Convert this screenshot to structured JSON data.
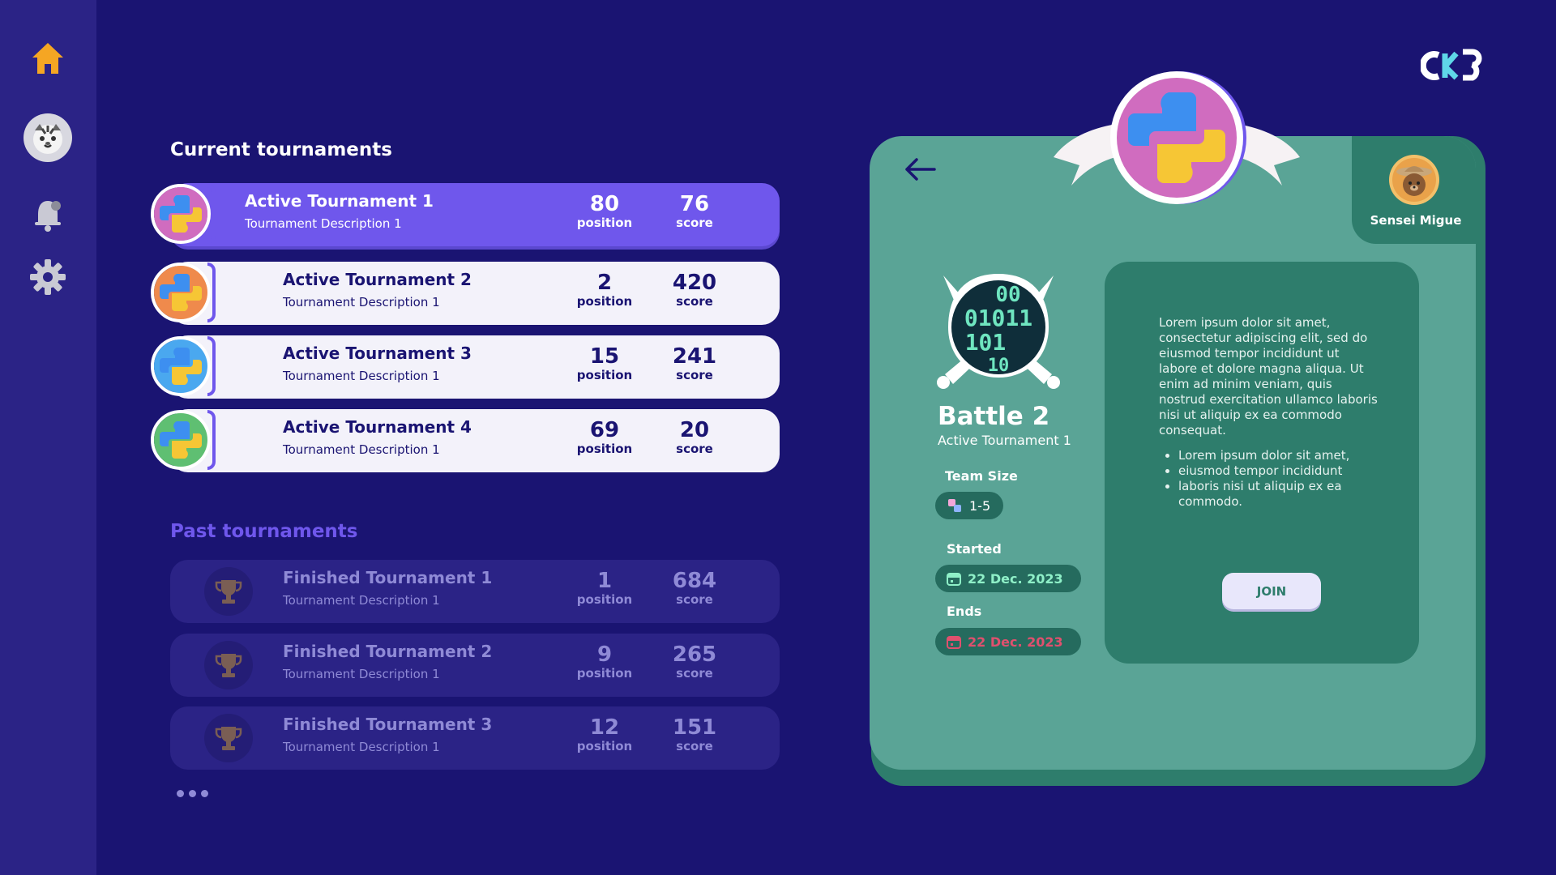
{
  "sidebar": {
    "items": [
      {
        "icon": "home-icon"
      },
      {
        "icon": "avatar-tiger-icon"
      },
      {
        "icon": "bell-icon"
      },
      {
        "icon": "gear-icon"
      }
    ]
  },
  "brand": {
    "logo": "ck3-logo"
  },
  "current": {
    "title": "Current tournaments",
    "rows": [
      {
        "name": "Active Tournament 1",
        "desc": "Tournament Description 1",
        "position": "80",
        "score": "76",
        "position_label": "position",
        "score_label": "score",
        "badge_color": "#d06cbf"
      },
      {
        "name": "Active Tournament 2",
        "desc": "Tournament Description 1",
        "position": "2",
        "score": "420",
        "position_label": "position",
        "score_label": "score",
        "badge_color": "#ef8a4c"
      },
      {
        "name": "Active Tournament 3",
        "desc": "Tournament Description 1",
        "position": "15",
        "score": "241",
        "position_label": "position",
        "score_label": "score",
        "badge_color": "#4aa8ef"
      },
      {
        "name": "Active Tournament 4",
        "desc": "Tournament Description 1",
        "position": "69",
        "score": "20",
        "position_label": "position",
        "score_label": "score",
        "badge_color": "#5fbf72"
      }
    ]
  },
  "past": {
    "title": "Past tournaments",
    "rows": [
      {
        "name": "Finished Tournament 1",
        "desc": "Tournament Description 1",
        "position": "1",
        "score": "684",
        "position_label": "position",
        "score_label": "score"
      },
      {
        "name": "Finished Tournament 2",
        "desc": "Tournament Description 1",
        "position": "9",
        "score": "265",
        "position_label": "position",
        "score_label": "score"
      },
      {
        "name": "Finished Tournament 3",
        "desc": "Tournament Description 1",
        "position": "12",
        "score": "151",
        "position_label": "position",
        "score_label": "score"
      }
    ]
  },
  "detail": {
    "battle_title": "Battle 2",
    "battle_subtitle": "Active Tournament 1",
    "team_size_label": "Team Size",
    "team_size": "1-5",
    "started_label": "Started",
    "started_date": "22 Dec. 2023",
    "ends_label": "Ends",
    "ends_date": "22 Dec. 2023",
    "tutor_name": "Sensei Migue",
    "description": "Lorem ipsum dolor sit amet, consectetur adipiscing elit, sed do eiusmod tempor incididunt ut labore et dolore magna aliqua. Ut enim ad minim veniam, quis nostrud exercitation ullamco laboris nisi ut aliquip ex ea commodo consequat.",
    "bullets": [
      "Lorem ipsum dolor sit amet,",
      "eiusmod tempor incididunt",
      "laboris nisi ut aliquip ex ea commodo."
    ],
    "join_label": "JOIN",
    "badge_digits": [
      "00",
      "01011",
      "101",
      "10"
    ],
    "colors": {
      "panel": "#5aa496",
      "panel_dark": "#2e7d6c",
      "accent": "#6f57ec",
      "ends_date": "#e0506e",
      "started_date": "#8ff0c8"
    }
  }
}
